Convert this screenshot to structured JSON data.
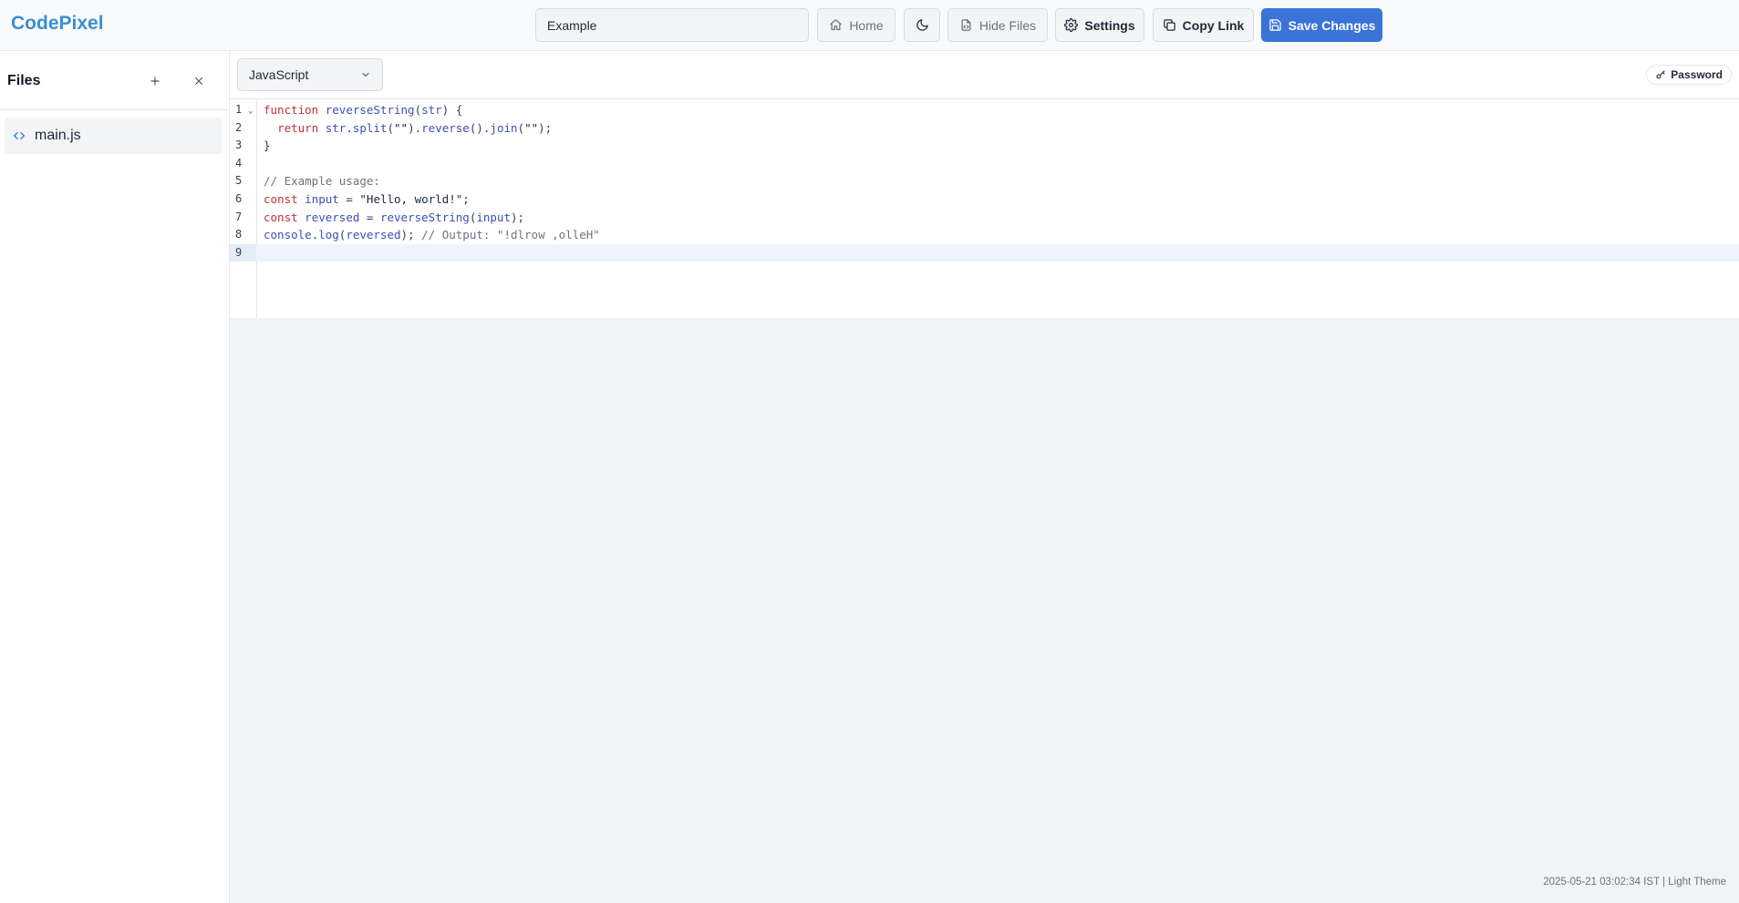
{
  "app": {
    "logo": "CodePixel"
  },
  "header": {
    "title_value": "Example",
    "home_label": "Home",
    "hide_files_label": "Hide Files",
    "settings_label": "Settings",
    "copy_link_label": "Copy Link",
    "save_label": "Save Changes"
  },
  "sidebar": {
    "title": "Files",
    "files": [
      {
        "name": "main.js"
      }
    ]
  },
  "editor": {
    "language": "JavaScript",
    "password_label": "Password",
    "line_numbers": [
      "1",
      "2",
      "3",
      "4",
      "5",
      "6",
      "7",
      "8",
      "9"
    ],
    "lines": [
      "function reverseString(str) {",
      "  return str.split(\"\").reverse().join(\"\");",
      "}",
      "",
      "// Example usage:",
      "const input = \"Hello, world!\";",
      "const reversed = reverseString(input);",
      "console.log(reversed); // Output: \"!dlrow ,olleH\"",
      ""
    ],
    "active_line": 9
  },
  "status": {
    "text": "2025-05-21 03:02:34 IST | Light Theme"
  },
  "colors": {
    "brand": "#3b8fd0",
    "primary": "#3b73d8",
    "keyword": "#c2303c",
    "function": "#3b4fb8"
  },
  "icons": {
    "home": "home-icon",
    "theme": "moon-icon",
    "hide_files": "file-code-icon",
    "settings": "gear-icon",
    "copy": "copy-icon",
    "save": "floppy-disk-icon",
    "add": "plus-icon",
    "close": "close-icon",
    "file": "code-icon",
    "dropdown": "chevron-down-icon",
    "password": "key-icon"
  }
}
